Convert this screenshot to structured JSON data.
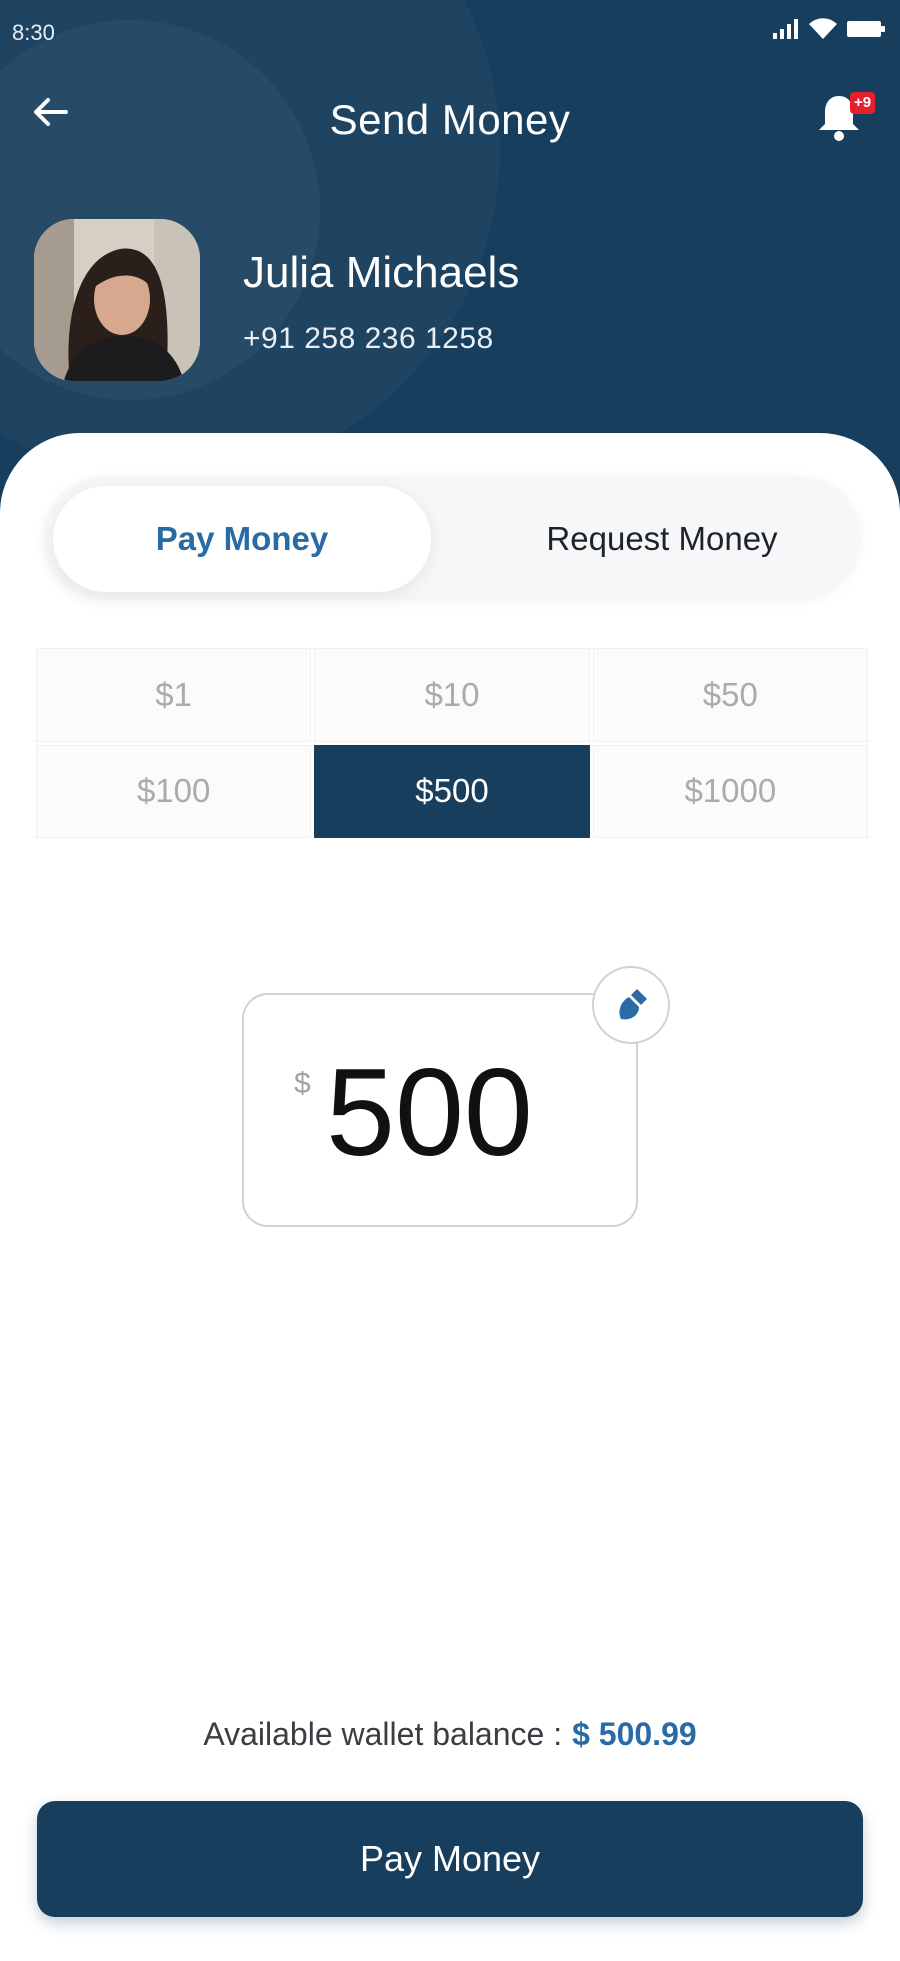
{
  "status_bar": {
    "time": "8:30",
    "icons": [
      "signal-icon",
      "wifi-icon",
      "battery-icon"
    ]
  },
  "header": {
    "title": "Send Money",
    "back_icon": "arrow-left-icon",
    "notification_icon": "bell-icon",
    "notification_badge": "+9"
  },
  "contact": {
    "name": "Julia Michaels",
    "phone": "+91 258 236 1258"
  },
  "mode_toggle": {
    "options": [
      "Pay Money",
      "Request Money"
    ],
    "selected": "Pay Money"
  },
  "quick_amounts": {
    "options": [
      "$1",
      "$10",
      "$50",
      "$100",
      "$500",
      "$1000"
    ],
    "selected": "$500"
  },
  "amount_input": {
    "currency_symbol": "$",
    "value": "500",
    "edit_icon": "brush-icon"
  },
  "wallet": {
    "label": "Available wallet balance :",
    "balance": "$ 500.99"
  },
  "primary_action": {
    "label": "Pay Money"
  },
  "colors": {
    "primary": "#173e5c",
    "accent": "#2a6aa5",
    "badge": "#e5202e"
  }
}
